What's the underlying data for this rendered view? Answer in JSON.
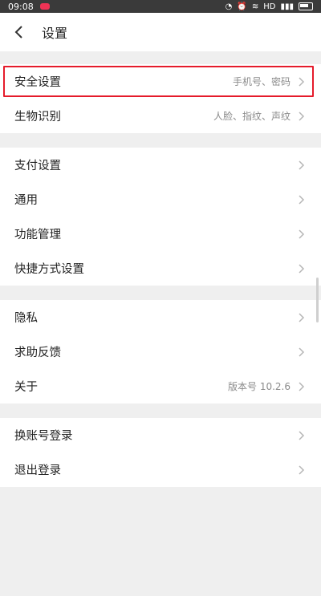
{
  "status_bar": {
    "time": "09:08",
    "right": "HD"
  },
  "nav": {
    "title": "设置"
  },
  "groups": [
    {
      "items": [
        {
          "label": "安全设置",
          "value": "手机号、密码",
          "highlighted": true
        },
        {
          "label": "生物识别",
          "value": "人脸、指纹、声纹"
        }
      ]
    },
    {
      "items": [
        {
          "label": "支付设置",
          "value": ""
        },
        {
          "label": "通用",
          "value": ""
        },
        {
          "label": "功能管理",
          "value": ""
        },
        {
          "label": "快捷方式设置",
          "value": ""
        }
      ]
    },
    {
      "items": [
        {
          "label": "隐私",
          "value": ""
        },
        {
          "label": "求助反馈",
          "value": ""
        },
        {
          "label": "关于",
          "value": "版本号 10.2.6"
        }
      ]
    },
    {
      "items": [
        {
          "label": "换账号登录",
          "value": ""
        },
        {
          "label": "退出登录",
          "value": ""
        }
      ]
    }
  ],
  "icons": {
    "back": "back-arrow-icon",
    "chevron": "chevron-right-icon"
  }
}
